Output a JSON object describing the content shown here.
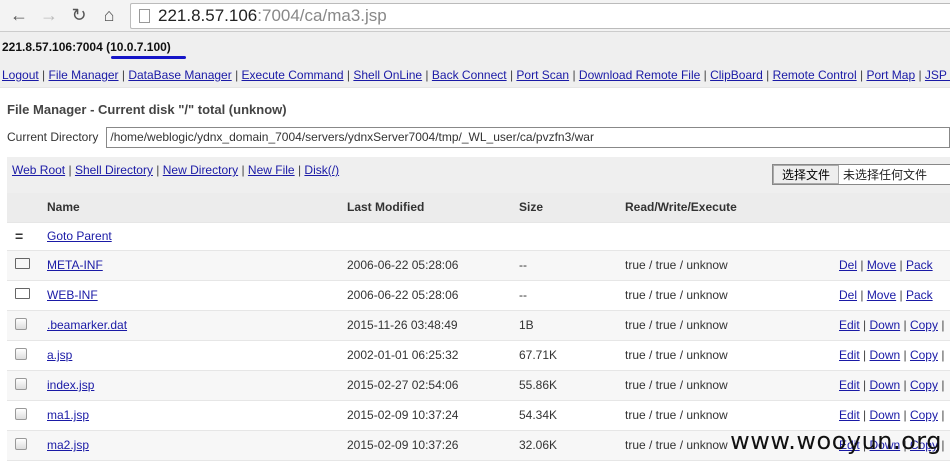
{
  "browser": {
    "url_host": "221.8.57.106",
    "url_rest": ":7004/ca/ma3.jsp"
  },
  "host": {
    "label": "221.8.57.106:7004 ",
    "ip": "(10.0.7.100)"
  },
  "menu": [
    "Logout",
    "File Manager",
    "DataBase Manager",
    "Execute Command",
    "Shell OnLine",
    "Back Connect",
    "Port Scan",
    "Download Remote File",
    "ClipBoard",
    "Remote Control",
    "Port Map",
    "JSP Env"
  ],
  "title": "File Manager - Current disk \"/\" total (unknow)",
  "directory": {
    "label": "Current Directory",
    "value": "/home/weblogic/ydnx_domain_7004/servers/ydnxServer7004/tmp/_WL_user/ca/pvzfn3/war"
  },
  "tools": [
    "Web Root",
    "Shell Directory",
    "New Directory",
    "New File",
    "Disk(/)"
  ],
  "upload": {
    "button": "选择文件",
    "status": "未选择任何文件"
  },
  "table": {
    "headers": [
      "Name",
      "Last Modified",
      "Size",
      "Read/Write/Execute"
    ],
    "parent": {
      "icon": "=",
      "label": "Goto Parent"
    },
    "rows": [
      {
        "type": "folder",
        "name": "META-INF",
        "modified": "2006-06-22 05:28:06",
        "size": "--",
        "rwx": "true / true / unknow",
        "actions": [
          "Del",
          "Move",
          "Pack"
        ]
      },
      {
        "type": "folder",
        "name": "WEB-INF",
        "modified": "2006-06-22 05:28:06",
        "size": "--",
        "rwx": "true / true / unknow",
        "actions": [
          "Del",
          "Move",
          "Pack"
        ]
      },
      {
        "type": "file",
        "name": ".beamarker.dat",
        "modified": "2015-11-26 03:48:49",
        "size": "1B",
        "rwx": "true / true / unknow",
        "actions": [
          "Edit",
          "Down",
          "Copy"
        ]
      },
      {
        "type": "file",
        "name": "a.jsp",
        "modified": "2002-01-01 06:25:32",
        "size": "67.71K",
        "rwx": "true / true / unknow",
        "actions": [
          "Edit",
          "Down",
          "Copy"
        ]
      },
      {
        "type": "file",
        "name": "index.jsp",
        "modified": "2015-02-27 02:54:06",
        "size": "55.86K",
        "rwx": "true / true / unknow",
        "actions": [
          "Edit",
          "Down",
          "Copy"
        ]
      },
      {
        "type": "file",
        "name": "ma1.jsp",
        "modified": "2015-02-09 10:37:24",
        "size": "54.34K",
        "rwx": "true / true / unknow",
        "actions": [
          "Edit",
          "Down",
          "Copy"
        ]
      },
      {
        "type": "file",
        "name": "ma2.jsp",
        "modified": "2015-02-09 10:37:26",
        "size": "32.06K",
        "rwx": "true / true / unknow",
        "actions": [
          "Edit",
          "Down",
          "Copy"
        ]
      }
    ]
  },
  "watermark": "www.wooyun.org"
}
